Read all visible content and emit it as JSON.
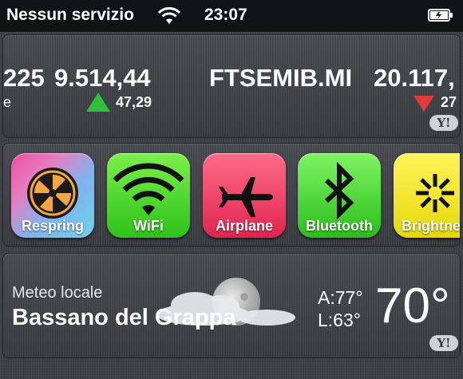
{
  "status_bar": {
    "carrier": "Nessun servizio",
    "time": "23:07"
  },
  "stocks": [
    {
      "value_cut": "225",
      "price": "9.514,44",
      "change": "47,29",
      "direction": "up",
      "name_cut": "e"
    },
    {
      "symbol": "FTSEMIB.MI",
      "price": "20.117,",
      "change": "27",
      "direction": "down"
    }
  ],
  "yahoo_badge": "Y!",
  "toggles": [
    {
      "label": "Respring",
      "icon": "respring-icon"
    },
    {
      "label": "WiFi",
      "icon": "wifi-icon"
    },
    {
      "label": "Airplane",
      "icon": "airplane-icon"
    },
    {
      "label": "Bluetooth",
      "icon": "bluetooth-icon"
    },
    {
      "label": "Brightnes",
      "icon": "brightness-icon"
    }
  ],
  "weather": {
    "title": "Meteo locale",
    "city": "Bassano del Grappa",
    "high": "A:77°",
    "low": "L:63°",
    "temp": "70°"
  },
  "colors": {
    "up": "#2fbf3a",
    "down": "#e23a3a"
  }
}
